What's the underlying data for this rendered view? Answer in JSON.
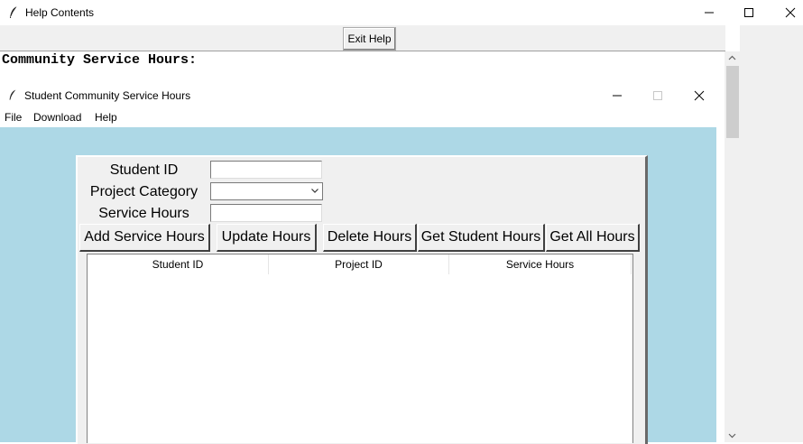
{
  "window": {
    "title": "Help Contents",
    "exit_label": "Exit Help",
    "heading": "Community Service Hours:"
  },
  "app": {
    "title": "Student Community Service Hours",
    "menu": [
      "File",
      "Download",
      "Help"
    ],
    "form": {
      "student_id_label": "Student ID",
      "project_category_label": "Project Category",
      "service_hours_label": "Service Hours",
      "student_id_value": "",
      "project_category_value": "",
      "service_hours_value": ""
    },
    "buttons": {
      "add": "Add Service Hours",
      "update": "Update Hours",
      "delete": "Delete Hours",
      "get_student": "Get Student Hours",
      "get_all": "Get All Hours"
    },
    "table": {
      "columns": [
        "Student ID",
        "Project ID",
        "Service Hours"
      ],
      "rows": []
    }
  },
  "colors": {
    "client_background": "#add8e6",
    "panel": "#f0f0f0"
  }
}
